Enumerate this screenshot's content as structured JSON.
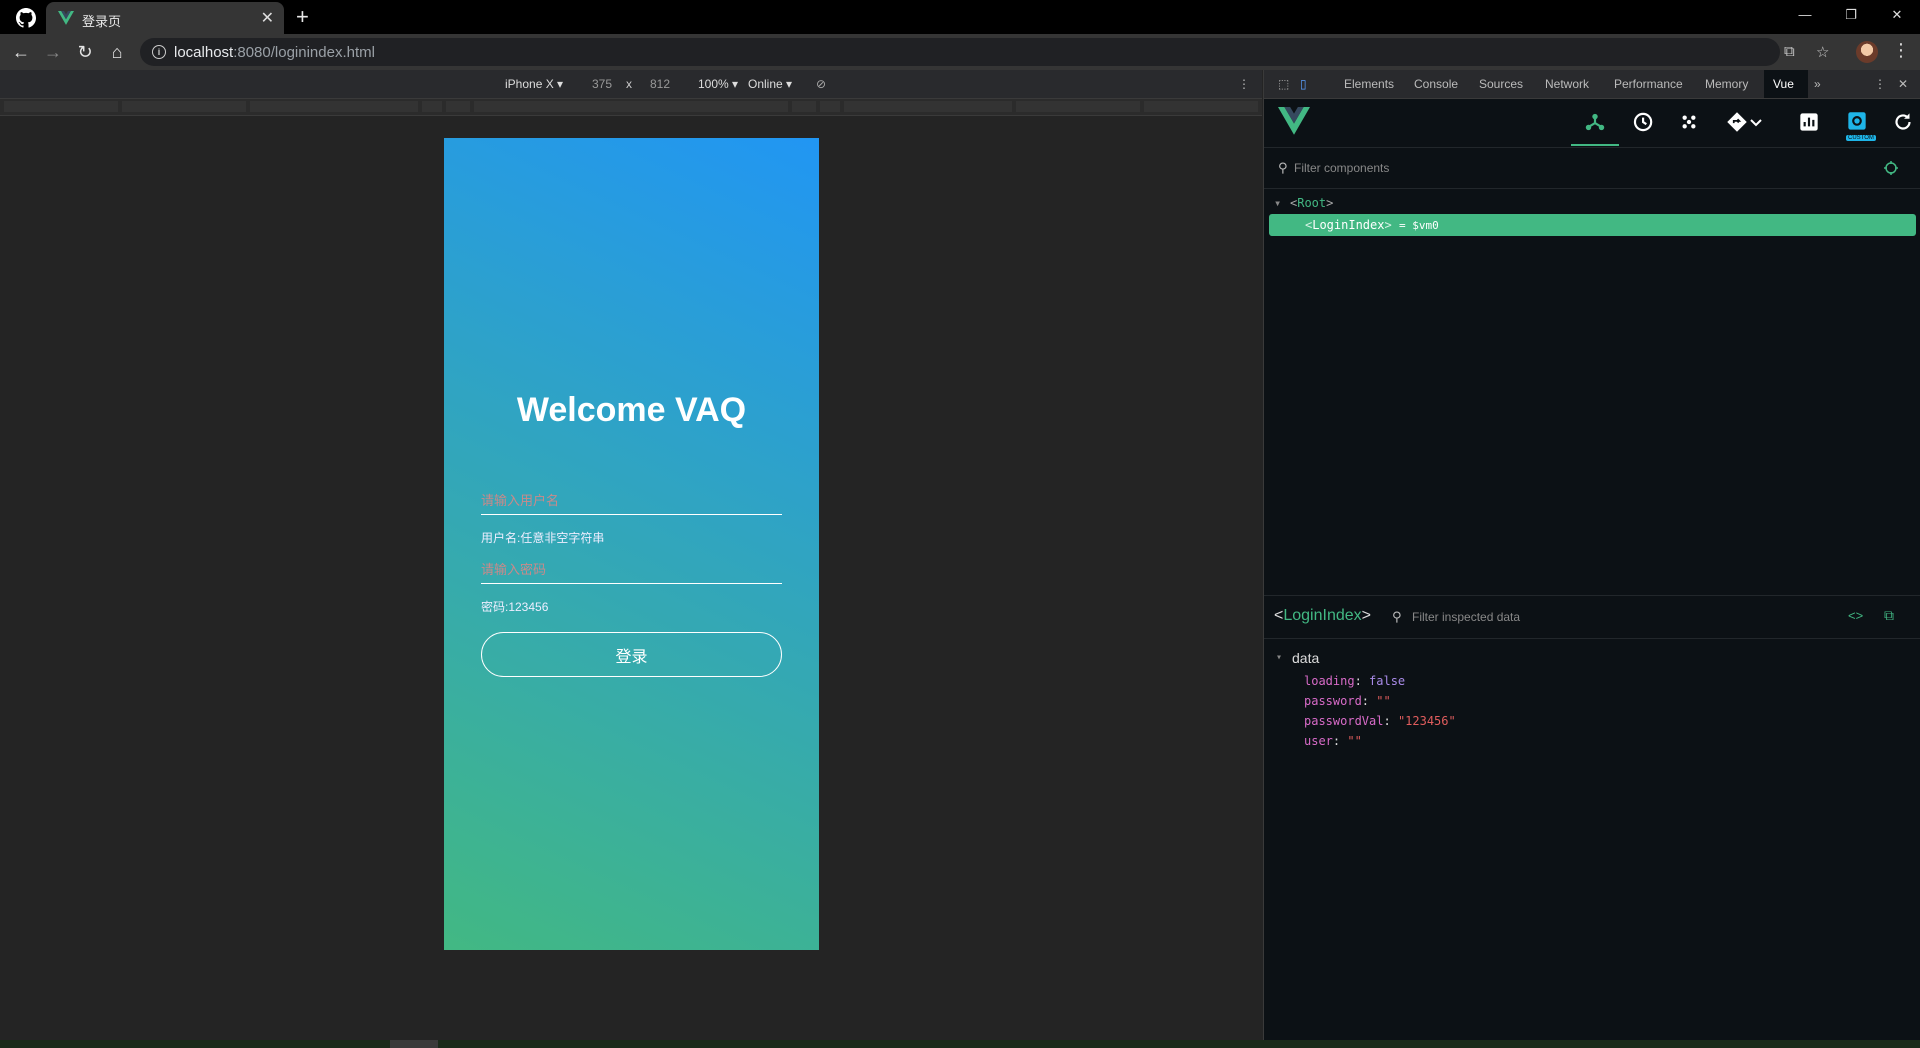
{
  "browser": {
    "tab_title": "登录页",
    "tab_close": "✕",
    "newtab": "+",
    "url_host": "localhost",
    "url_rest": ":8080/loginindex.html",
    "window": {
      "minimize": "—",
      "restore": "❐",
      "close": "✕"
    }
  },
  "device_toolbar": {
    "device": "iPhone X ▾",
    "width": "375",
    "times": "x",
    "height": "812",
    "zoom": "100% ▾",
    "network": "Online ▾"
  },
  "page": {
    "title": "Welcome VAQ",
    "username_placeholder": "请输入用户名",
    "username_hint": "用户名:任意非空字符串",
    "password_placeholder": "请输入密码",
    "password_hint": "密码:123456",
    "login_label": "登录"
  },
  "devtools": {
    "tabs": [
      "Elements",
      "Console",
      "Sources",
      "Network",
      "Performance",
      "Memory",
      "Vue"
    ],
    "active_tab": "Vue",
    "more": "»",
    "filter_components_placeholder": "Filter components",
    "tree": {
      "root": "Root",
      "child": "LoginIndex",
      "child_ref": "= $vm0"
    },
    "inspector": {
      "component": "LoginIndex",
      "filter_placeholder": "Filter inspected data",
      "section": "data",
      "props": [
        {
          "key": "loading",
          "value": "false",
          "kind": "bool"
        },
        {
          "key": "password",
          "value": "\"\"",
          "kind": "str"
        },
        {
          "key": "passwordVal",
          "value": "\"123456\"",
          "kind": "str"
        },
        {
          "key": "user",
          "value": "\"\"",
          "kind": "str"
        }
      ]
    },
    "badge": "CUSTOM"
  },
  "colors": {
    "vue_green": "#42b883",
    "gradient_top": "#2196f3",
    "gradient_bottom": "#42b883"
  }
}
